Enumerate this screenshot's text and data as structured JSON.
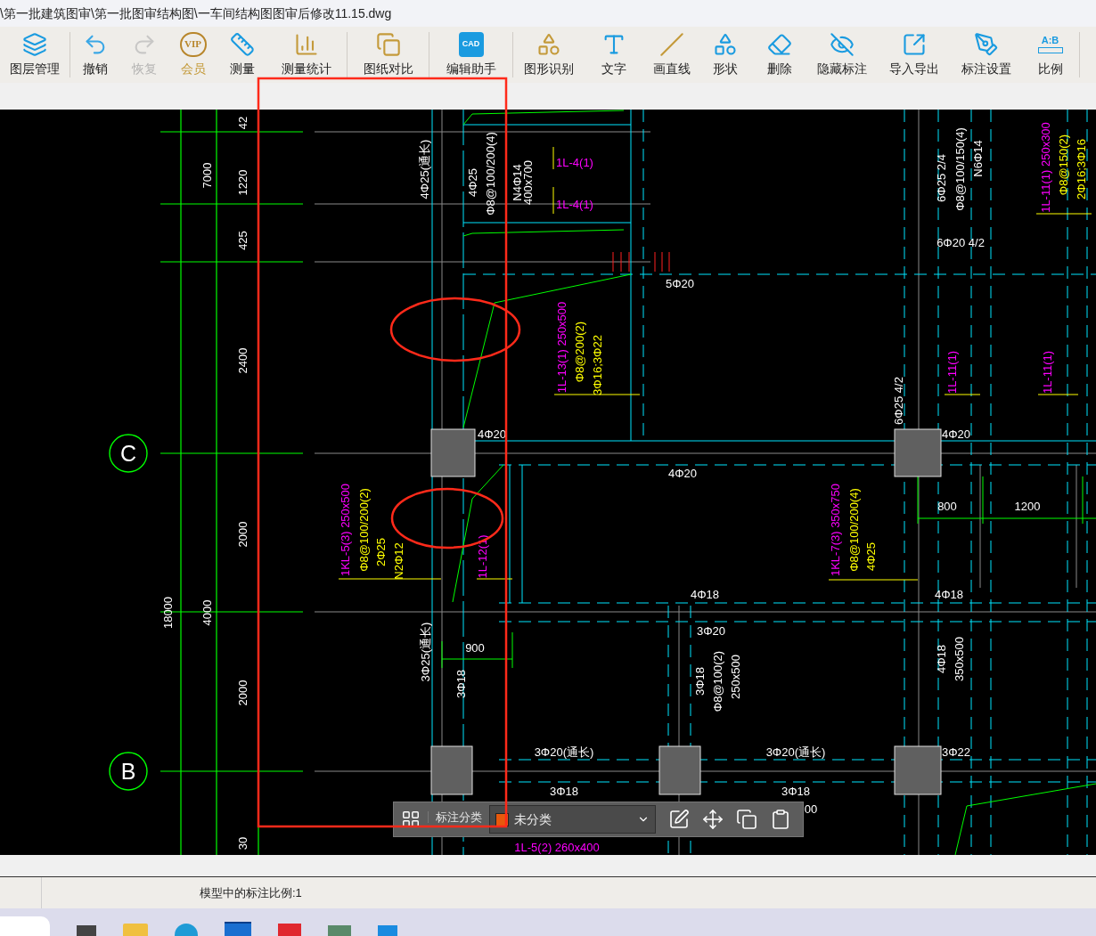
{
  "window": {
    "title": "\\第一批建筑图审\\第一批图审结构图\\一车间结构图图审后修改11.15.dwg"
  },
  "toolbar": [
    {
      "label": "图层管理",
      "disabled": false,
      "premium": false
    },
    {
      "label": "撤销",
      "disabled": false,
      "premium": false
    },
    {
      "label": "恢复",
      "disabled": true,
      "premium": false
    },
    {
      "label": "会员",
      "disabled": false,
      "premium": true,
      "icon_text": "VIP"
    },
    {
      "label": "测量",
      "disabled": false,
      "premium": false
    },
    {
      "label": "测量统计",
      "disabled": false,
      "premium": false
    },
    {
      "label": "图纸对比",
      "disabled": false,
      "premium": false
    },
    {
      "label": "编辑助手",
      "disabled": false,
      "premium": false,
      "icon_text": "CAD"
    },
    {
      "label": "图形识别",
      "disabled": false,
      "premium": false
    },
    {
      "label": "文字",
      "disabled": false,
      "premium": false
    },
    {
      "label": "画直线",
      "disabled": false,
      "premium": false
    },
    {
      "label": "形状",
      "disabled": false,
      "premium": false
    },
    {
      "label": "删除",
      "disabled": false,
      "premium": false
    },
    {
      "label": "隐藏标注",
      "disabled": false,
      "premium": false
    },
    {
      "label": "导入导出",
      "disabled": false,
      "premium": false
    },
    {
      "label": "标注设置",
      "disabled": false,
      "premium": false
    },
    {
      "label": "比例",
      "disabled": false,
      "premium": false,
      "icon_text": "A:B"
    }
  ],
  "canvas": {
    "axes": [
      "C",
      "B"
    ],
    "labels": [
      {
        "text": "42",
        "color": "#ffffff"
      },
      {
        "text": "1220",
        "color": "#ffffff"
      },
      {
        "text": "425",
        "color": "#ffffff"
      },
      {
        "text": "2400",
        "color": "#ffffff"
      },
      {
        "text": "7000",
        "color": "#ffffff"
      },
      {
        "text": "2000",
        "color": "#ffffff"
      },
      {
        "text": "2000",
        "color": "#ffffff"
      },
      {
        "text": "18000",
        "color": "#ffffff"
      },
      {
        "text": "4000",
        "color": "#ffffff"
      },
      {
        "text": "30",
        "color": "#ffffff"
      },
      {
        "text": "4Φ25(通长)",
        "color": "#ffffff"
      },
      {
        "text": "4Φ25",
        "color": "#ffffff"
      },
      {
        "text": "Φ8@100/200(4)",
        "color": "#ffffff"
      },
      {
        "text": "N4Φ14",
        "color": "#ffffff"
      },
      {
        "text": "400x700",
        "color": "#ffffff"
      },
      {
        "text": "1L-4(1)",
        "color": "#ff00ff"
      },
      {
        "text": "1L-4(1)",
        "color": "#ff00ff"
      },
      {
        "text": "5Φ20",
        "color": "#ffffff"
      },
      {
        "text": "1L-13(1) 250x500",
        "color": "#ff00ff"
      },
      {
        "text": "Φ8@200(2)",
        "color": "#ffff00"
      },
      {
        "text": "3Φ16;3Φ22",
        "color": "#ffff00"
      },
      {
        "text": "4Φ20",
        "color": "#ffffff"
      },
      {
        "text": "4Φ20",
        "color": "#ffffff"
      },
      {
        "text": "6Φ25 2/4",
        "color": "#ffffff"
      },
      {
        "text": "Φ8@100/150(4)",
        "color": "#ffffff"
      },
      {
        "text": "N6Φ14",
        "color": "#ffffff"
      },
      {
        "text": "1L-11(1) 250x300",
        "color": "#ff00ff"
      },
      {
        "text": "Φ8@150(2)",
        "color": "#ffff00"
      },
      {
        "text": "2Φ16;3Φ16",
        "color": "#ffff00"
      },
      {
        "text": "6Φ20 4/2",
        "color": "#ffffff"
      },
      {
        "text": "6Φ25 4/2",
        "color": "#ffffff"
      },
      {
        "text": "1L-11(1)",
        "color": "#ff00ff"
      },
      {
        "text": "1L-11(1)",
        "color": "#ff00ff"
      },
      {
        "text": "4Φ20",
        "color": "#ffffff"
      },
      {
        "text": "800",
        "color": "#ffffff"
      },
      {
        "text": "1200",
        "color": "#ffffff"
      },
      {
        "text": "1KL-5(3) 250x500",
        "color": "#ff00ff"
      },
      {
        "text": "Φ8@100/200(2)",
        "color": "#ffff00"
      },
      {
        "text": "2Φ25",
        "color": "#ffff00"
      },
      {
        "text": "N2Φ12",
        "color": "#ffff00"
      },
      {
        "text": "1L-12(1)",
        "color": "#ff00ff"
      },
      {
        "text": "1KL-7(3) 350x750",
        "color": "#ff00ff"
      },
      {
        "text": "Φ8@100/200(4)",
        "color": "#ffff00"
      },
      {
        "text": "4Φ25",
        "color": "#ffff00"
      },
      {
        "text": "4Φ18",
        "color": "#ffffff"
      },
      {
        "text": "4Φ18",
        "color": "#ffffff"
      },
      {
        "text": "3Φ20",
        "color": "#ffffff"
      },
      {
        "text": "3Φ18",
        "color": "#ffffff"
      },
      {
        "text": "Φ8@100(2)",
        "color": "#ffffff"
      },
      {
        "text": "250x500",
        "color": "#ffffff"
      },
      {
        "text": "4Φ18",
        "color": "#ffffff"
      },
      {
        "text": "350x500",
        "color": "#ffffff"
      },
      {
        "text": "900",
        "color": "#ffffff"
      },
      {
        "text": "3Φ25(通长)",
        "color": "#ffffff"
      },
      {
        "text": "3Φ18",
        "color": "#ffffff"
      },
      {
        "text": "3Φ20(通长)",
        "color": "#ffffff"
      },
      {
        "text": "3Φ20(通长)",
        "color": "#ffffff"
      },
      {
        "text": "3Φ22",
        "color": "#ffffff"
      },
      {
        "text": "3Φ18",
        "color": "#ffffff"
      },
      {
        "text": "3Φ18",
        "color": "#ffffff"
      },
      {
        "text": "00",
        "color": "#ffffff"
      },
      {
        "text": "1L-5(2) 260x400",
        "color": "#ff00ff"
      }
    ]
  },
  "annotation_toolbar": {
    "label": "标注分类",
    "category": {
      "value": "未分类",
      "color": "#e8590c"
    }
  },
  "status_bar": {
    "text": "模型中的标注比例:1"
  }
}
